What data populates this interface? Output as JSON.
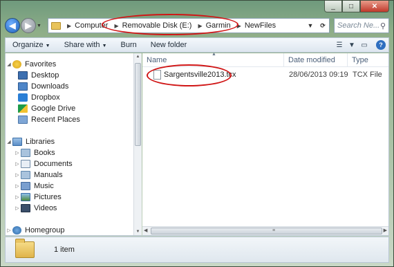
{
  "window": {
    "caption_min": "_",
    "caption_max": "□",
    "caption_close": "✕"
  },
  "address": {
    "crumbs": [
      "Computer",
      "Removable Disk (E:)",
      "Garmin",
      "NewFiles"
    ],
    "search_placeholder": "Search Ne..."
  },
  "toolbar": {
    "organize": "Organize",
    "share_with": "Share with",
    "burn": "Burn",
    "new_folder": "New folder"
  },
  "nav": {
    "favorites": {
      "label": "Favorites",
      "items": [
        "Desktop",
        "Downloads",
        "Dropbox",
        "Google Drive",
        "Recent Places"
      ]
    },
    "libraries": {
      "label": "Libraries",
      "items": [
        "Books",
        "Documents",
        "Manuals",
        "Music",
        "Pictures",
        "Videos"
      ]
    },
    "homegroup": "Homegroup"
  },
  "columns": {
    "name": "Name",
    "date_modified": "Date modified",
    "type": "Type"
  },
  "files": [
    {
      "name": "Sargentsville2013.tcx",
      "date": "28/06/2013 09:19",
      "type": "TCX File"
    }
  ],
  "status": {
    "count": "1 item"
  },
  "colors": {
    "highlight_ellipse": "#d01515",
    "accent_blue": "#1d5fb8"
  }
}
